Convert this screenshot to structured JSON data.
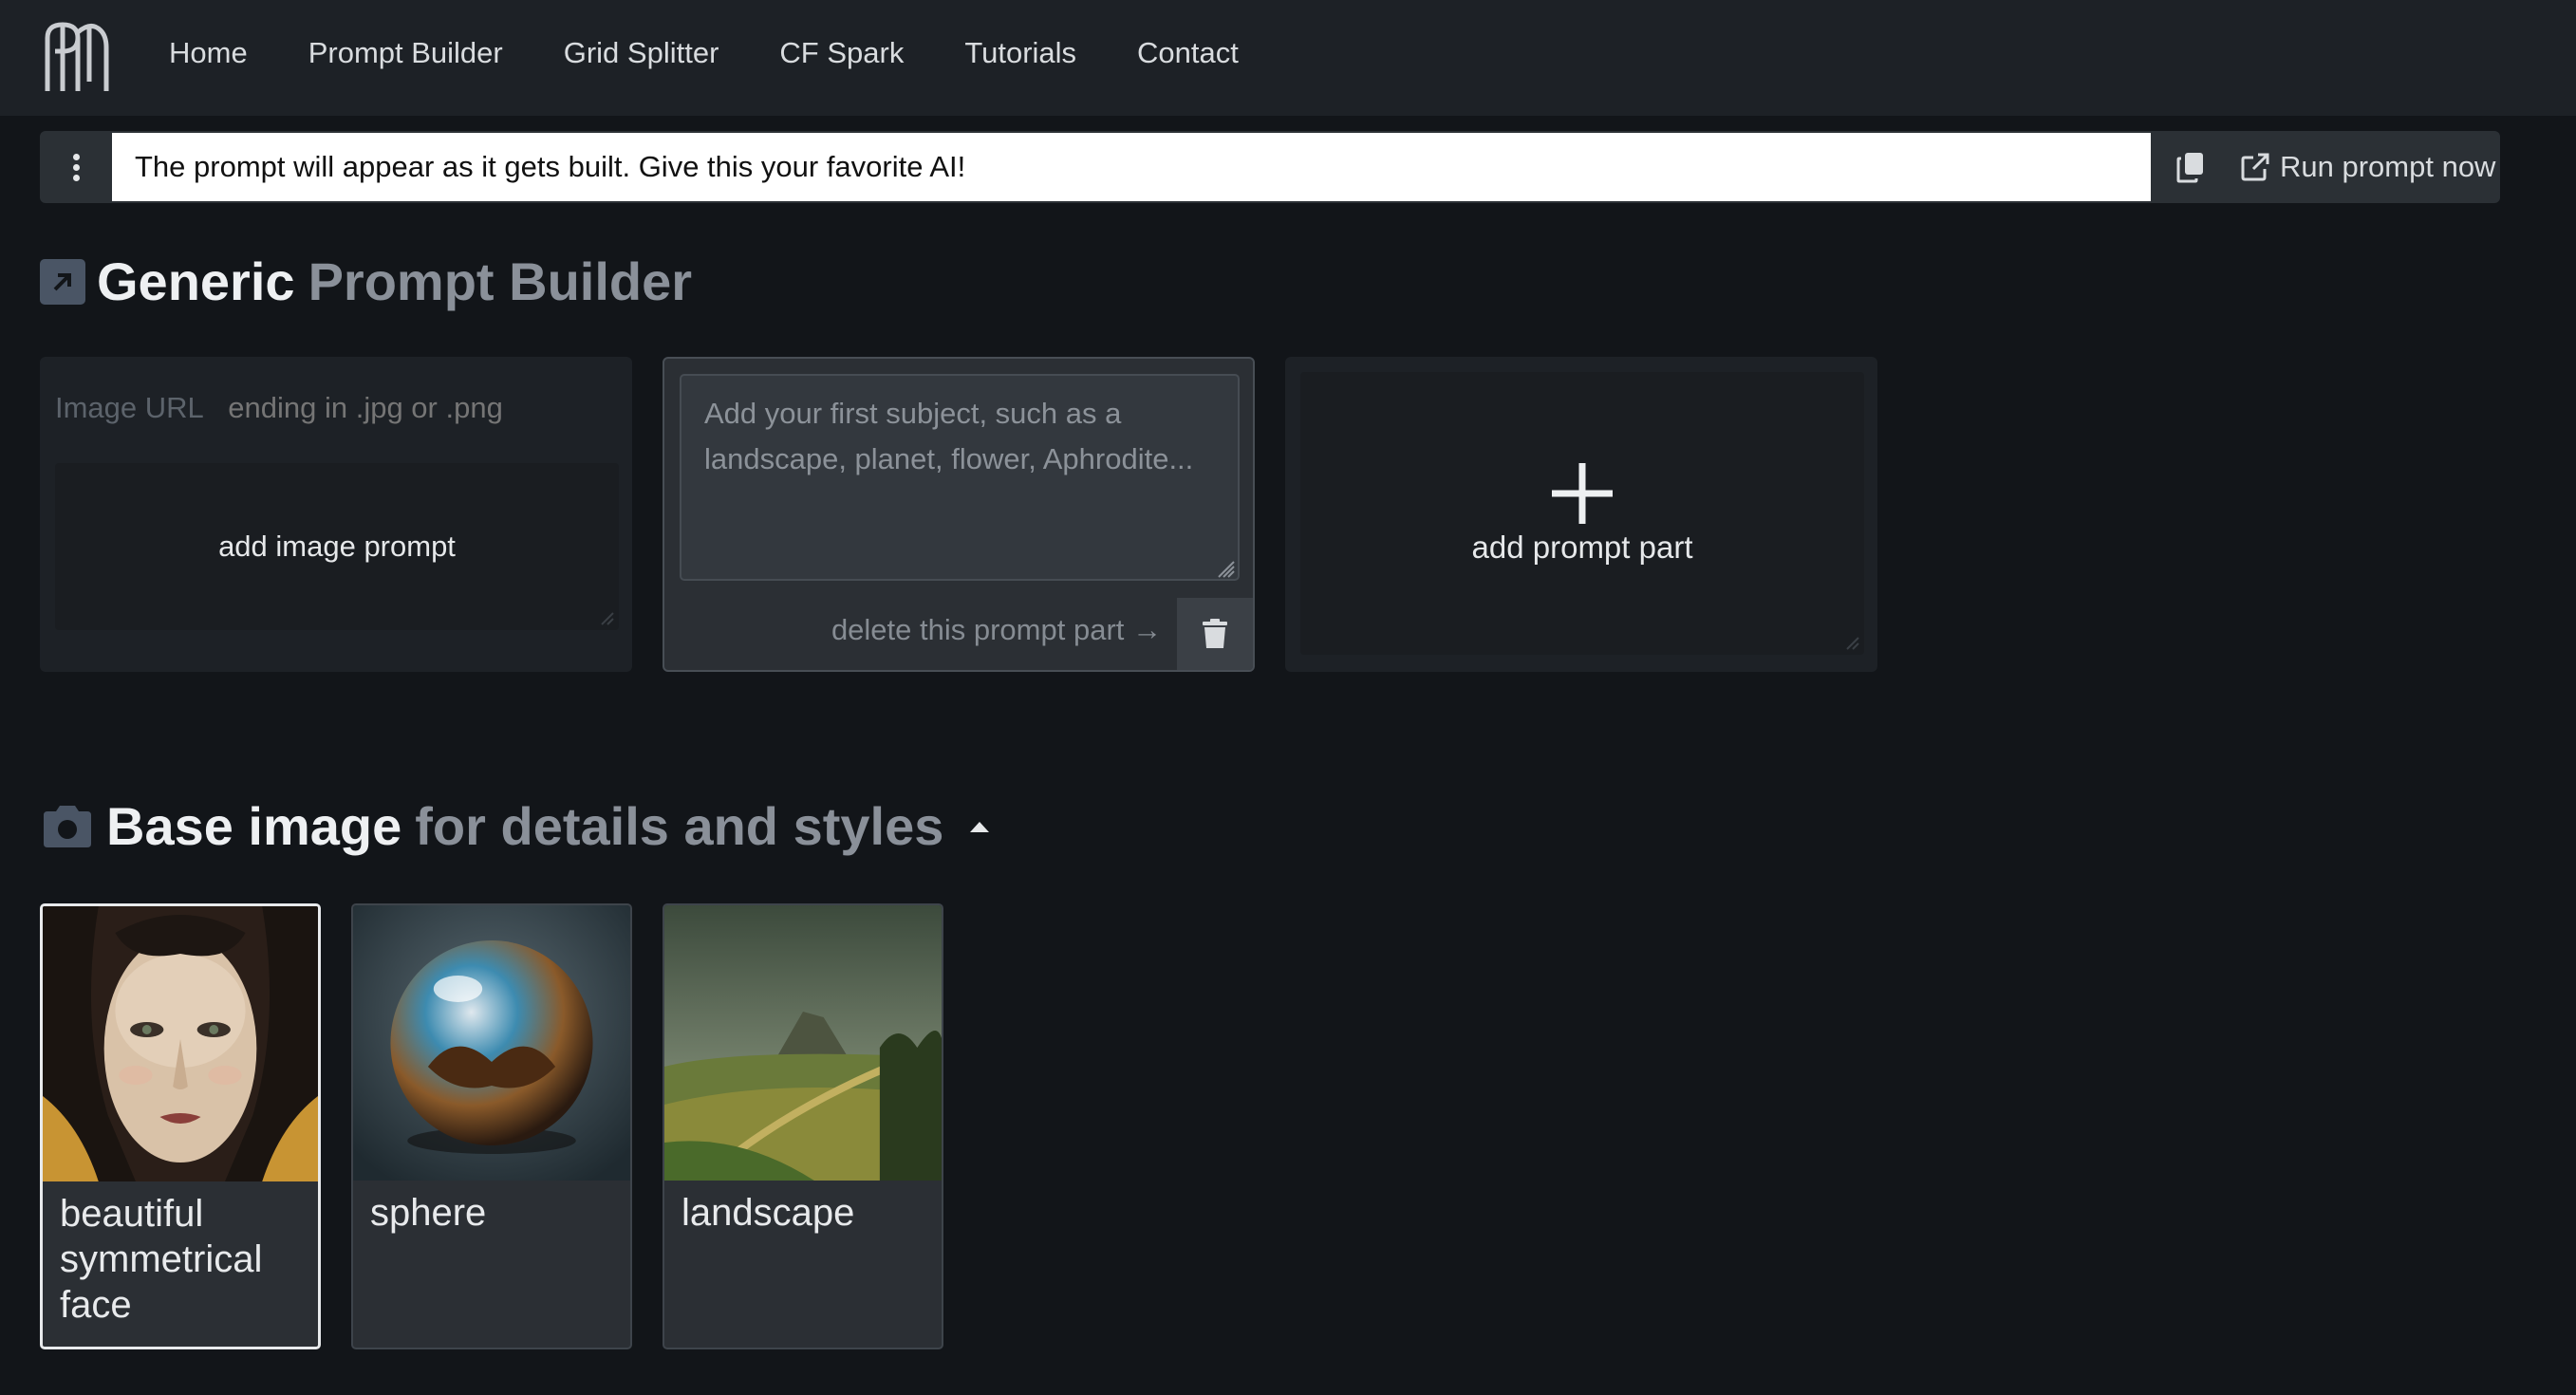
{
  "nav": {
    "logo_icon": "pm-monogram-logo",
    "links": [
      "Home",
      "Prompt Builder",
      "Grid Splitter",
      "CF Spark",
      "Tutorials",
      "Contact"
    ]
  },
  "prompt_bar": {
    "menu_icon": "kebab-menu-icon",
    "output_text": "The prompt will appear as it gets built. Give this your favorite AI!",
    "copy_icon": "copy-icon",
    "run_label": "Run prompt now",
    "run_icon": "external-link-icon"
  },
  "builder": {
    "title_main": "Generic",
    "title_sub": "Prompt Builder",
    "title_icon": "arrow-up-right-icon",
    "image_card": {
      "url_label": "Image URL",
      "url_placeholder": "ending in .jpg or .png",
      "add_label": "add image prompt"
    },
    "subject_card": {
      "placeholder": "Add your first subject, such as a landscape, planet, flower, Aphrodite...",
      "delete_label": "delete this prompt part →",
      "trash_icon": "trash-icon"
    },
    "add_part": {
      "label": "add prompt part",
      "icon": "plus-icon"
    }
  },
  "base_image": {
    "title_main": "Base image",
    "title_sub": "for details and styles",
    "title_icon": "camera-icon",
    "toggle_icon": "caret-up-icon",
    "tiles": [
      {
        "label": "beautiful symmetrical face",
        "selected": true
      },
      {
        "label": "sphere",
        "selected": false
      },
      {
        "label": "landscape",
        "selected": false
      }
    ]
  },
  "colors": {
    "page_bg": "#121519",
    "navbar_bg": "#1d2126",
    "card_bg": "#1d2126",
    "muted_text": "#8a9099"
  }
}
